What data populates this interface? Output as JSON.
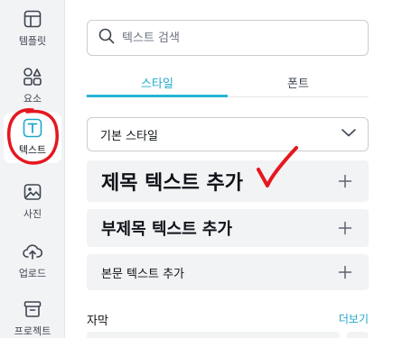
{
  "sidebar": {
    "items": [
      {
        "label": "템플릿",
        "icon": "template-icon"
      },
      {
        "label": "요소",
        "icon": "elements-icon"
      },
      {
        "label": "텍스트",
        "icon": "text-icon",
        "active": true
      },
      {
        "label": "사진",
        "icon": "photo-icon"
      },
      {
        "label": "업로드",
        "icon": "upload-icon"
      },
      {
        "label": "프로젝트",
        "icon": "projects-icon"
      }
    ]
  },
  "search": {
    "placeholder": "텍스트 검색"
  },
  "tabs": [
    {
      "label": "스타일",
      "active": true
    },
    {
      "label": "폰트",
      "active": false
    }
  ],
  "style_select": {
    "value": "기본 스타일"
  },
  "text_options": [
    {
      "label": "제목 텍스트 추가"
    },
    {
      "label": "부제목 텍스트 추가"
    },
    {
      "label": "본문 텍스트 추가"
    }
  ],
  "subtitle_section": {
    "title": "자막",
    "more": "더보기"
  },
  "colors": {
    "accent": "#24b6d4",
    "annotation": "#e5171f",
    "row_bg": "#f2f3f5"
  }
}
